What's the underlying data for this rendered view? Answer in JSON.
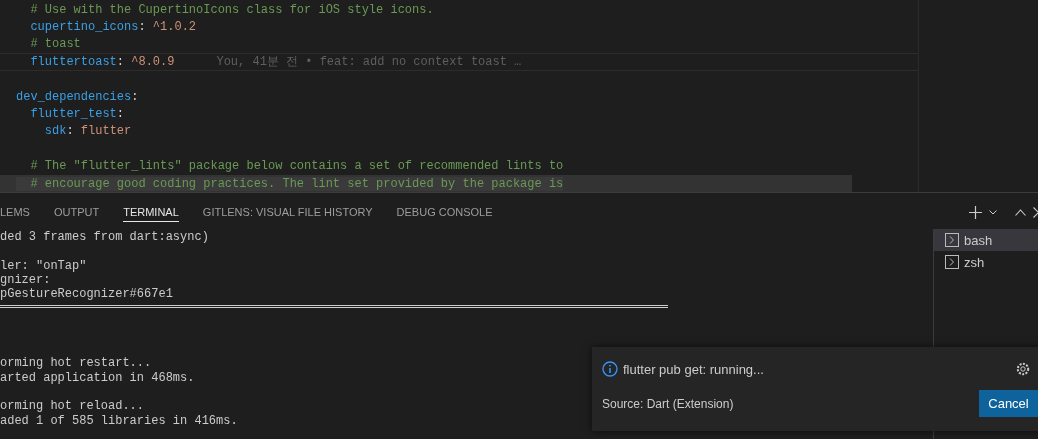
{
  "editor": {
    "lines": [
      {
        "kind": "code",
        "current_line": false,
        "selected": false,
        "segments": [
          {
            "kind": "comment",
            "text": "  # Use with the CupertinoIcons class for iOS style icons."
          }
        ]
      },
      {
        "kind": "code",
        "current_line": false,
        "selected": false,
        "segments": [
          {
            "kind": "key",
            "text": "  cupertino_icons"
          },
          {
            "kind": "punct",
            "text": ": "
          },
          {
            "kind": "value",
            "text": "^1.0.2"
          }
        ]
      },
      {
        "kind": "code",
        "current_line": false,
        "selected": false,
        "segments": [
          {
            "kind": "comment",
            "text": "  # toast"
          }
        ]
      },
      {
        "kind": "code",
        "current_line": true,
        "selected": false,
        "segments": [
          {
            "kind": "key",
            "text": "  fluttertoast"
          },
          {
            "kind": "punct",
            "text": ": "
          },
          {
            "kind": "value",
            "text": "^8.0.9"
          }
        ],
        "blame": "You, 41분 전 • feat: add no context toast …"
      },
      {
        "kind": "blank",
        "current_line": false,
        "selected": false
      },
      {
        "kind": "code",
        "current_line": false,
        "selected": false,
        "segments": [
          {
            "kind": "key",
            "text": "dev_dependencies"
          },
          {
            "kind": "punct",
            "text": ":"
          }
        ]
      },
      {
        "kind": "code",
        "current_line": false,
        "selected": false,
        "segments": [
          {
            "kind": "key",
            "text": "  flutter_test"
          },
          {
            "kind": "punct",
            "text": ":"
          }
        ]
      },
      {
        "kind": "code",
        "current_line": false,
        "selected": false,
        "segments": [
          {
            "kind": "key",
            "text": "    sdk"
          },
          {
            "kind": "punct",
            "text": ": "
          },
          {
            "kind": "value",
            "text": "flutter"
          }
        ]
      },
      {
        "kind": "blank",
        "current_line": false,
        "selected": false
      },
      {
        "kind": "code",
        "current_line": false,
        "selected": false,
        "segments": [
          {
            "kind": "comment",
            "text": "  # The \"flutter_lints\" package below contains a set of recommended lints to"
          }
        ]
      },
      {
        "kind": "code",
        "current_line": false,
        "selected": true,
        "segments": [
          {
            "kind": "comment",
            "text": "  # encourage good coding practices. The lint set provided by the package is"
          }
        ]
      }
    ]
  },
  "panel": {
    "tabs": [
      {
        "label": "LEMS",
        "selected": false
      },
      {
        "label": "OUTPUT",
        "selected": false
      },
      {
        "label": "TERMINAL",
        "selected": true
      },
      {
        "label": "GITLENS: VISUAL FILE HISTORY",
        "selected": false
      },
      {
        "label": "DEBUG CONSOLE",
        "selected": false
      }
    ],
    "terminal_lines": [
      {
        "kind": "text",
        "text": "ded 3 frames from dart:async)"
      },
      {
        "kind": "blank"
      },
      {
        "kind": "text",
        "text": "ler: \"onTap\""
      },
      {
        "kind": "text",
        "text": "gnizer:"
      },
      {
        "kind": "text",
        "text": "pGestureRecognizer#667e1"
      },
      {
        "kind": "rule"
      },
      {
        "kind": "blank"
      },
      {
        "kind": "blank"
      },
      {
        "kind": "blank"
      },
      {
        "kind": "text",
        "text": "orming hot restart..."
      },
      {
        "kind": "text",
        "text": "arted application in 468ms."
      },
      {
        "kind": "blank"
      },
      {
        "kind": "text",
        "text": "orming hot reload..."
      },
      {
        "kind": "text",
        "text": "aded 1 of 585 libraries in 416ms."
      }
    ],
    "sessions": [
      {
        "name": "bash",
        "selected": true
      },
      {
        "name": "zsh",
        "selected": false
      }
    ]
  },
  "notification": {
    "message": "flutter pub get: running...",
    "source": "Source: Dart (Extension)",
    "button": "Cancel"
  }
}
